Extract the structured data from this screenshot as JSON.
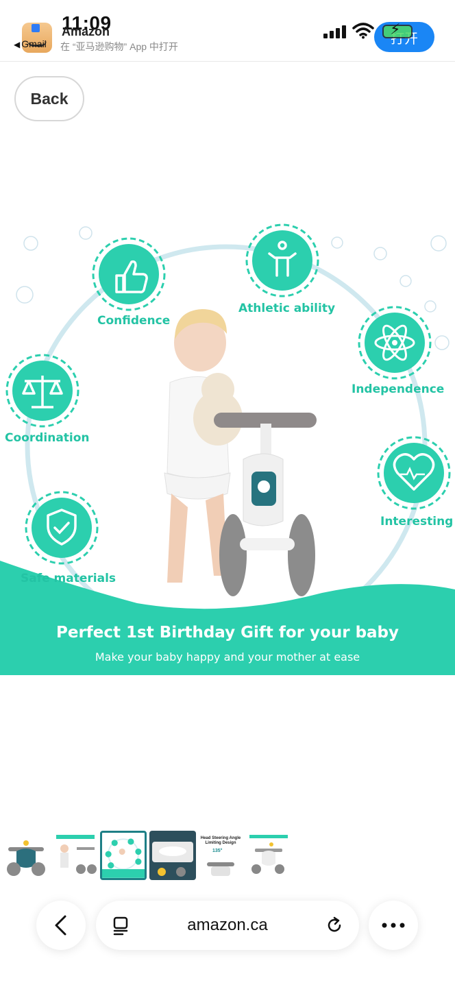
{
  "status_bar": {
    "time": "11:09",
    "app_name": "Amazon",
    "back_to_app": "Gmail",
    "app_subtitle": "在 “亚马逊购物” App 中打开",
    "open_button": "打开"
  },
  "page": {
    "back_button": "Back"
  },
  "product_image": {
    "features": [
      "Confidence",
      "Athletic ability",
      "Independence",
      "Coordination",
      "Interesting",
      "Safe materials"
    ],
    "banner_title": "Perfect 1st Birthday Gift for your baby",
    "banner_subtitle": "Make your baby happy and your mother at ease",
    "accent_color": "#23c3a4"
  },
  "thumbnails": {
    "count": 6,
    "selected_index": 2,
    "thumb_4_caption": "Head Steering Angle Limiting Design",
    "thumb_4_badge": "135°"
  },
  "browser": {
    "url": "amazon.ca"
  }
}
